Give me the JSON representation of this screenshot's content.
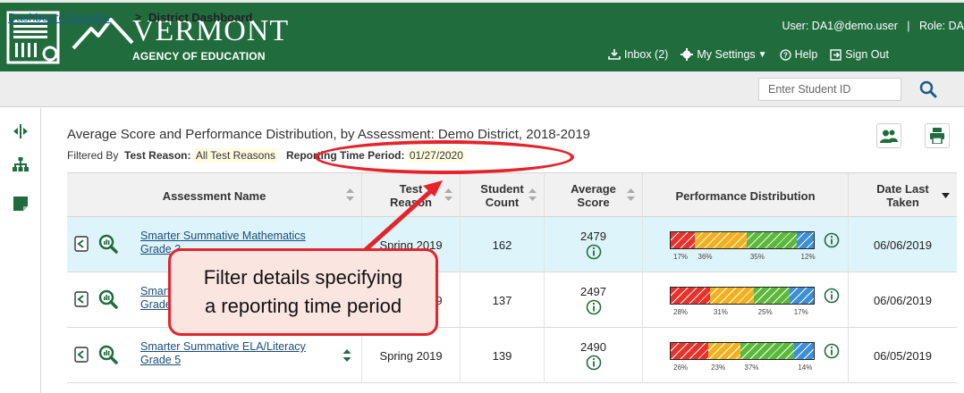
{
  "header": {
    "brand_name": "VERMONT",
    "brand_sub": "AGENCY OF EDUCATION",
    "user_label": "User: DA1@demo.user",
    "role_label": "Role: DA",
    "nav": [
      {
        "label": "Inbox (2)",
        "icon": "inbox-icon"
      },
      {
        "label": "My Settings",
        "icon": "gear-icon"
      },
      {
        "label": "Help",
        "icon": "help-icon"
      },
      {
        "label": "Sign Out",
        "icon": "sign-out-icon"
      }
    ],
    "colors": {
      "brand_green": "#216c3d"
    }
  },
  "breadcrumb": {
    "link": "Dashboard Selector",
    "separator": ">",
    "current": "District Dashboard"
  },
  "search": {
    "placeholder": "Enter Student ID",
    "icon": "search-icon"
  },
  "rail": [
    "expand-collapse-icon",
    "hierarchy-icon",
    "note-icon"
  ],
  "report": {
    "title": "Average Score and Performance Distribution, by Assessment: Demo District, 2018-2019",
    "filter_prefix": "Filtered By",
    "filters": [
      {
        "label": "Test Reason:",
        "value": "All Test Reasons"
      },
      {
        "label": "Reporting Time Period:",
        "value": "01/27/2020"
      }
    ],
    "tools": [
      "students-icon",
      "print-icon"
    ]
  },
  "table": {
    "columns": [
      "Assessment Name",
      "Test Reason",
      "Student Count",
      "Average Score",
      "Performance Distribution",
      "Date Last Taken"
    ],
    "rows": [
      {
        "name_line1": "Smarter Summative Mathematics",
        "name_line2": "Grade 3",
        "test_reason": "Spring 2019",
        "count": "162",
        "avg": "2479",
        "dist": [
          17,
          36,
          35,
          12
        ],
        "date": "06/06/2019",
        "highlighted": true
      },
      {
        "name_line1": "Smarter Summative Mathematics",
        "name_line2": "Grade 4",
        "test_reason": "Spring 2019",
        "count": "137",
        "avg": "2497",
        "dist": [
          28,
          31,
          25,
          17
        ],
        "date": "06/06/2019",
        "highlighted": false
      },
      {
        "name_line1": "Smarter Summative ELA/Literacy",
        "name_line2": "Grade 5",
        "test_reason": "Spring 2019",
        "count": "139",
        "avg": "2490",
        "dist": [
          26,
          23,
          37,
          14
        ],
        "date": "06/05/2019",
        "highlighted": false
      }
    ],
    "dist_colors": [
      "#e8312b",
      "#f2b01e",
      "#5cb83a",
      "#3c8fd6"
    ]
  },
  "callout": {
    "line1": "Filter details specifying",
    "line2": "a reporting time period",
    "color": "#e5232b"
  }
}
